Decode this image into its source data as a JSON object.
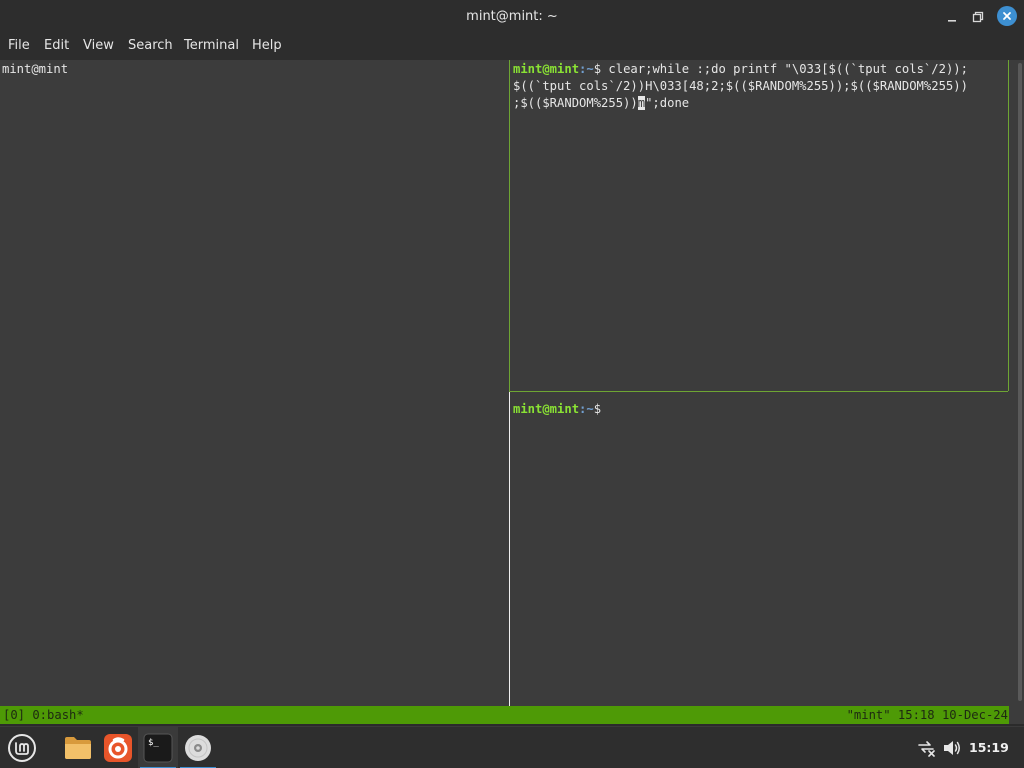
{
  "window": {
    "title": "mint@mint: ~",
    "minimize_icon": "minimize-icon",
    "maximize_icon": "maximize-icon",
    "close_icon": "close-icon"
  },
  "menubar": {
    "items": [
      "File",
      "Edit",
      "View",
      "Search",
      "Terminal",
      "Help"
    ]
  },
  "terminal": {
    "left_pane": {
      "text": "mint@mint"
    },
    "top_right_pane": {
      "prompt_user": "mint@mint",
      "prompt_path": ":~",
      "prompt_symbol": "$",
      "line1": " clear;while :;do printf \"\\033[$((`tput cols`/2));",
      "line2": "$((`tput cols`/2))H\\033[48;2;$(($RANDOM%255));$(($RANDOM%255))",
      "line3_before_cursor": ";$(($RANDOM%255))",
      "cursor_char": "m",
      "line3_after_cursor": "\";done"
    },
    "bottom_right_pane": {
      "prompt_user": "mint@mint",
      "prompt_path": ":~",
      "prompt_symbol": "$"
    }
  },
  "status_bar": {
    "left": "[0] 0:bash*",
    "right": "\"mint\" 15:18 10-Dec-24"
  },
  "taskbar": {
    "menu_icon": "linux-mint-menu-icon",
    "apps": [
      {
        "name": "files-icon",
        "label": "Files"
      },
      {
        "name": "firefox-icon",
        "label": "Firefox"
      },
      {
        "name": "terminal-icon",
        "label": "Terminal"
      },
      {
        "name": "disc-icon",
        "label": "Disc"
      }
    ],
    "tray": {
      "network_icon": "network-disconnected-icon",
      "volume_icon": "volume-icon",
      "clock": "15:19"
    }
  },
  "colors": {
    "prompt_green": "#8ae234",
    "prompt_blue": "#729fcf",
    "pane_border_green": "#6ea533",
    "status_bar_green": "#4e9a06",
    "accent_blue": "#3d8fd1"
  }
}
